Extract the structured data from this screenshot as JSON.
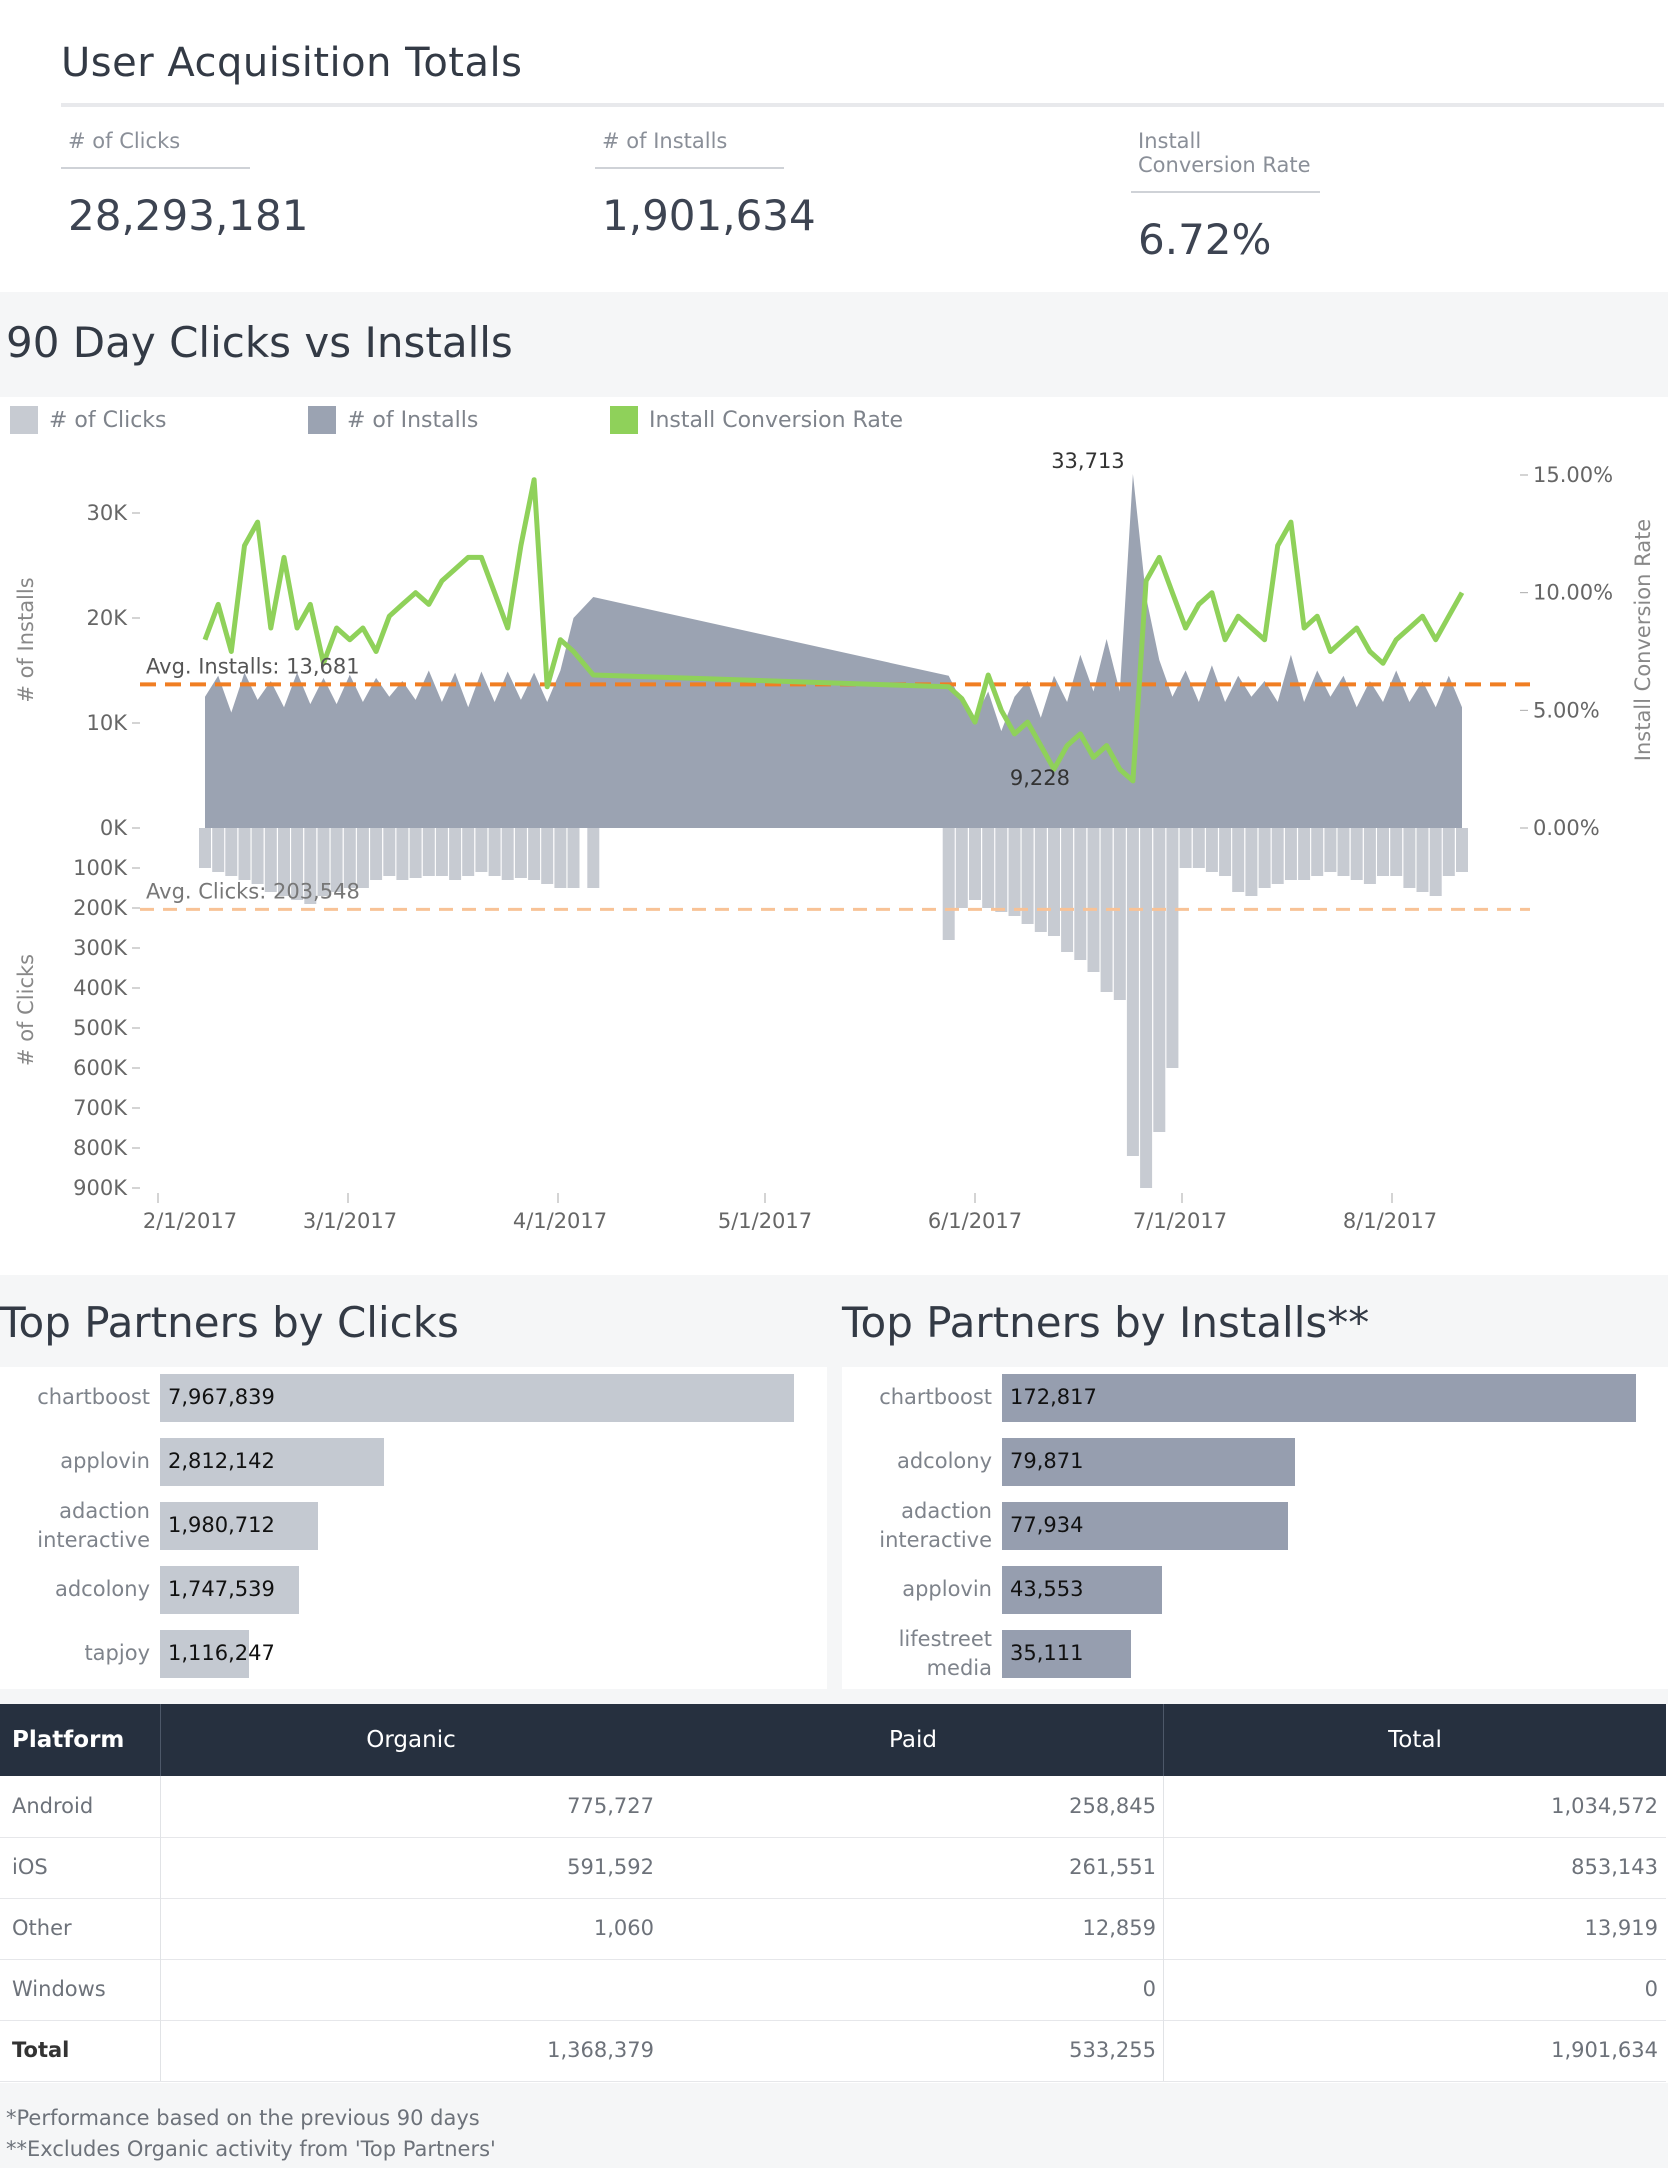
{
  "kpi": {
    "title": "User Acquisition Totals",
    "clicks_label": "# of Clicks",
    "clicks_value": "28,293,181",
    "installs_label": "# of Installs",
    "installs_value": "1,901,634",
    "rate_label": "Install Conversion Rate",
    "rate_value": "6.72%"
  },
  "chart": {
    "title": "90 Day Clicks vs Installs",
    "legend": [
      "# of Clicks",
      "# of Installs",
      "Install Conversion Rate"
    ],
    "colors": {
      "clicks": "#c7cbd2",
      "installs": "#9ba3b2",
      "rate": "#8fd15a",
      "avg_installs": "#f07e23",
      "avg_clicks": "#f8c296"
    }
  },
  "chart_data": {
    "type": "area",
    "title": "90 Day Clicks vs Installs",
    "x_ticks": [
      "2/1/2017",
      "3/1/2017",
      "4/1/2017",
      "5/1/2017",
      "6/1/2017",
      "7/1/2017",
      "8/1/2017"
    ],
    "x_range": [
      "2017-02-01",
      "2017-08-11"
    ],
    "installs_axis": {
      "label": "# of Installs",
      "ticks": [
        "0K",
        "10K",
        "20K",
        "30K"
      ],
      "range": [
        0,
        34000
      ]
    },
    "clicks_axis": {
      "label": "# of Clicks",
      "ticks": [
        "100K",
        "200K",
        "300K",
        "400K",
        "500K",
        "600K",
        "700K",
        "800K",
        "900K"
      ],
      "range": [
        0,
        900000
      ],
      "inverted": true
    },
    "rate_axis": {
      "label": "Install Conversion Rate",
      "ticks": [
        "0.00%",
        "5.00%",
        "10.00%",
        "15.00%"
      ],
      "range": [
        0,
        15.5
      ]
    },
    "avg_installs": {
      "label": "Avg. Installs: 13,681",
      "value": 13681
    },
    "avg_clicks": {
      "label": "Avg. Clicks: 203,548",
      "value": 203548
    },
    "annotations": [
      {
        "text": "33,713",
        "x": "2017-06-22",
        "y": 33713
      },
      {
        "text": "9,228",
        "x": "2017-06-03",
        "y": 9228
      }
    ],
    "series": [
      {
        "name": "# of Installs",
        "x": [
          "2017-02-01",
          "2017-02-03",
          "2017-02-05",
          "2017-02-07",
          "2017-02-09",
          "2017-02-11",
          "2017-02-13",
          "2017-02-15",
          "2017-02-17",
          "2017-02-19",
          "2017-02-21",
          "2017-02-23",
          "2017-02-25",
          "2017-02-27",
          "2017-03-01",
          "2017-03-03",
          "2017-03-05",
          "2017-03-07",
          "2017-03-09",
          "2017-03-11",
          "2017-03-13",
          "2017-03-15",
          "2017-03-17",
          "2017-03-19",
          "2017-03-21",
          "2017-03-23",
          "2017-03-25",
          "2017-03-27",
          "2017-03-29",
          "2017-04-01",
          "2017-05-25",
          "2017-05-27",
          "2017-05-29",
          "2017-05-31",
          "2017-06-02",
          "2017-06-04",
          "2017-06-06",
          "2017-06-08",
          "2017-06-10",
          "2017-06-12",
          "2017-06-14",
          "2017-06-16",
          "2017-06-18",
          "2017-06-20",
          "2017-06-22",
          "2017-06-24",
          "2017-06-26",
          "2017-06-28",
          "2017-06-30",
          "2017-07-02",
          "2017-07-04",
          "2017-07-06",
          "2017-07-08",
          "2017-07-10",
          "2017-07-12",
          "2017-07-14",
          "2017-07-16",
          "2017-07-18",
          "2017-07-20",
          "2017-07-22",
          "2017-07-24",
          "2017-07-26",
          "2017-07-28",
          "2017-07-30",
          "2017-08-01",
          "2017-08-03",
          "2017-08-05",
          "2017-08-07",
          "2017-08-09",
          "2017-08-11"
        ],
        "values": [
          12500,
          14500,
          11000,
          14800,
          12200,
          14000,
          11500,
          14800,
          11800,
          14300,
          11800,
          14600,
          12000,
          14300,
          12500,
          14000,
          12200,
          15000,
          12000,
          14800,
          11500,
          14900,
          12000,
          14900,
          12200,
          14800,
          12000,
          15000,
          20000,
          22000,
          14500,
          12000,
          10500,
          13000,
          9228,
          12500,
          14000,
          10500,
          14500,
          12000,
          16500,
          13000,
          18000,
          13000,
          33713,
          22000,
          16000,
          12500,
          15000,
          12000,
          15500,
          12000,
          14500,
          12500,
          14000,
          12000,
          16500,
          12000,
          15000,
          12500,
          14500,
          11500,
          14000,
          12000,
          15000,
          12000,
          14000,
          11500,
          14500,
          11500
        ]
      },
      {
        "name": "# of Clicks",
        "x": [
          "2017-02-01",
          "2017-02-03",
          "2017-02-05",
          "2017-02-07",
          "2017-02-09",
          "2017-02-11",
          "2017-02-13",
          "2017-02-15",
          "2017-02-17",
          "2017-02-19",
          "2017-02-21",
          "2017-02-23",
          "2017-02-25",
          "2017-02-27",
          "2017-03-01",
          "2017-03-03",
          "2017-03-05",
          "2017-03-07",
          "2017-03-09",
          "2017-03-11",
          "2017-03-13",
          "2017-03-15",
          "2017-03-17",
          "2017-03-19",
          "2017-03-21",
          "2017-03-23",
          "2017-03-25",
          "2017-03-27",
          "2017-03-29",
          "2017-04-01",
          "2017-05-25",
          "2017-05-27",
          "2017-05-29",
          "2017-05-31",
          "2017-06-02",
          "2017-06-04",
          "2017-06-06",
          "2017-06-08",
          "2017-06-10",
          "2017-06-12",
          "2017-06-14",
          "2017-06-16",
          "2017-06-18",
          "2017-06-20",
          "2017-06-22",
          "2017-06-24",
          "2017-06-26",
          "2017-06-28",
          "2017-06-30",
          "2017-07-02",
          "2017-07-04",
          "2017-07-06",
          "2017-07-08",
          "2017-07-10",
          "2017-07-12",
          "2017-07-14",
          "2017-07-16",
          "2017-07-18",
          "2017-07-20",
          "2017-07-22",
          "2017-07-24",
          "2017-07-26",
          "2017-07-28",
          "2017-07-30",
          "2017-08-01",
          "2017-08-03",
          "2017-08-05",
          "2017-08-07",
          "2017-08-09",
          "2017-08-11"
        ],
        "values": [
          100000,
          110000,
          120000,
          130000,
          140000,
          160000,
          170000,
          180000,
          190000,
          170000,
          160000,
          150000,
          150000,
          130000,
          120000,
          130000,
          125000,
          120000,
          120000,
          130000,
          120000,
          110000,
          120000,
          130000,
          125000,
          130000,
          140000,
          150000,
          150000,
          150000,
          280000,
          200000,
          180000,
          200000,
          210000,
          220000,
          240000,
          260000,
          270000,
          310000,
          330000,
          360000,
          410000,
          430000,
          820000,
          900000,
          760000,
          600000,
          100000,
          100000,
          110000,
          120000,
          160000,
          170000,
          150000,
          140000,
          130000,
          130000,
          120000,
          110000,
          120000,
          130000,
          140000,
          120000,
          120000,
          150000,
          160000,
          170000,
          120000,
          110000
        ]
      },
      {
        "name": "Install Conversion Rate",
        "x": [
          "2017-02-01",
          "2017-02-03",
          "2017-02-05",
          "2017-02-07",
          "2017-02-09",
          "2017-02-11",
          "2017-02-13",
          "2017-02-15",
          "2017-02-17",
          "2017-02-19",
          "2017-02-21",
          "2017-02-23",
          "2017-02-25",
          "2017-02-27",
          "2017-03-01",
          "2017-03-03",
          "2017-03-05",
          "2017-03-07",
          "2017-03-09",
          "2017-03-11",
          "2017-03-13",
          "2017-03-15",
          "2017-03-17",
          "2017-03-19",
          "2017-03-21",
          "2017-03-23",
          "2017-03-25",
          "2017-03-27",
          "2017-03-29",
          "2017-04-01",
          "2017-05-25",
          "2017-05-27",
          "2017-05-29",
          "2017-05-31",
          "2017-06-02",
          "2017-06-04",
          "2017-06-06",
          "2017-06-08",
          "2017-06-10",
          "2017-06-12",
          "2017-06-14",
          "2017-06-16",
          "2017-06-18",
          "2017-06-20",
          "2017-06-22",
          "2017-06-24",
          "2017-06-26",
          "2017-06-28",
          "2017-06-30",
          "2017-07-02",
          "2017-07-04",
          "2017-07-06",
          "2017-07-08",
          "2017-07-10",
          "2017-07-12",
          "2017-07-14",
          "2017-07-16",
          "2017-07-18",
          "2017-07-20",
          "2017-07-22",
          "2017-07-24",
          "2017-07-26",
          "2017-07-28",
          "2017-07-30",
          "2017-08-01",
          "2017-08-03",
          "2017-08-05",
          "2017-08-07",
          "2017-08-09",
          "2017-08-11"
        ],
        "values": [
          8.0,
          9.5,
          7.5,
          12.0,
          13.0,
          8.5,
          11.5,
          8.5,
          9.5,
          7.0,
          8.5,
          8.0,
          8.5,
          7.5,
          9.0,
          9.5,
          10.0,
          9.5,
          10.5,
          11.0,
          11.5,
          11.5,
          10.0,
          8.5,
          12.0,
          14.8,
          6.0,
          8.0,
          7.5,
          6.5,
          6.0,
          5.5,
          4.5,
          6.5,
          5.0,
          4.0,
          4.5,
          3.5,
          2.5,
          3.5,
          4.0,
          3.0,
          3.5,
          2.5,
          2.0,
          10.5,
          11.5,
          10.0,
          8.5,
          9.5,
          10.0,
          8.0,
          9.0,
          8.5,
          8.0,
          12.0,
          13.0,
          8.5,
          9.0,
          7.5,
          8.0,
          8.5,
          7.5,
          7.0,
          8.0,
          8.5,
          9.0,
          8.0,
          9.0,
          10.0
        ]
      }
    ]
  },
  "partners_clicks": {
    "title": "Top Partners by Clicks",
    "rows": [
      {
        "label": [
          "chartboost"
        ],
        "value": "7,967,839",
        "num": 7967839
      },
      {
        "label": [
          "applovin"
        ],
        "value": "2,812,142",
        "num": 2812142
      },
      {
        "label": [
          "adaction",
          "interactive"
        ],
        "value": "1,980,712",
        "num": 1980712
      },
      {
        "label": [
          "adcolony"
        ],
        "value": "1,747,539",
        "num": 1747539
      },
      {
        "label": [
          "tapjoy"
        ],
        "value": "1,116,247",
        "num": 1116247
      }
    ]
  },
  "partners_installs": {
    "title": "Top Partners by Installs**",
    "rows": [
      {
        "label": [
          "chartboost"
        ],
        "value": "172,817",
        "num": 172817
      },
      {
        "label": [
          "adcolony"
        ],
        "value": "79,871",
        "num": 79871
      },
      {
        "label": [
          "adaction",
          "interactive"
        ],
        "value": "77,934",
        "num": 77934
      },
      {
        "label": [
          "applovin"
        ],
        "value": "43,553",
        "num": 43553
      },
      {
        "label": [
          "lifestreet",
          "media"
        ],
        "value": "35,111",
        "num": 35111
      }
    ]
  },
  "table": {
    "headers": [
      "Platform",
      "Organic",
      "Paid",
      "Total"
    ],
    "rows": [
      [
        "Android",
        "775,727",
        "258,845",
        "1,034,572"
      ],
      [
        "iOS",
        "591,592",
        "261,551",
        "853,143"
      ],
      [
        "Other",
        "1,060",
        "12,859",
        "13,919"
      ],
      [
        "Windows",
        "",
        "0",
        "0"
      ],
      [
        "Total",
        "1,368,379",
        "533,255",
        "1,901,634"
      ]
    ]
  },
  "footnotes": [
    "*Performance based on the previous 90 days",
    "**Excludes Organic activity from 'Top Partners'"
  ]
}
